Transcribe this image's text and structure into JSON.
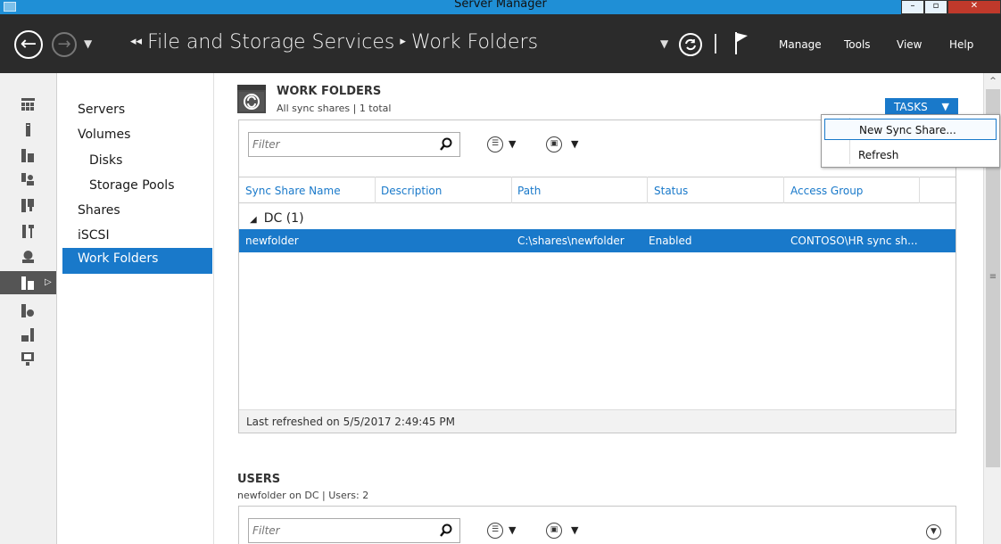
{
  "window": {
    "title": "Server Manager",
    "min": "–",
    "max": "▫",
    "close": "✕"
  },
  "header": {
    "back": "←",
    "forward": "→",
    "breadcrumb_arrows": "◂◂",
    "breadcrumb": [
      "File and Storage Services",
      "Work Folders"
    ],
    "breadcrumb_sep": "▸",
    "menus": [
      "Manage",
      "Tools",
      "View",
      "Help"
    ]
  },
  "sidebar": {
    "items": [
      "Servers",
      "Volumes",
      "Disks",
      "Storage Pools",
      "Shares",
      "iSCSI",
      "Work Folders"
    ],
    "active": "Work Folders"
  },
  "work_folders": {
    "title": "WORK FOLDERS",
    "subtitle": "All sync shares | 1 total",
    "tasks_label": "TASKS",
    "filter_placeholder": "Filter",
    "columns": [
      "Sync Share Name",
      "Description",
      "Path",
      "Status",
      "Access Group"
    ],
    "group": "DC (1)",
    "rows": [
      {
        "name": "newfolder",
        "description": "",
        "path": "C:\\shares\\newfolder",
        "status": "Enabled",
        "access_group": "CONTOSO\\HR sync sh..."
      }
    ],
    "last_refreshed": "Last refreshed on 5/5/2017 2:49:45 PM"
  },
  "users": {
    "title": "USERS",
    "subtitle": "newfolder on DC | Users: 2",
    "filter_placeholder": "Filter"
  },
  "tasks_menu": {
    "items": [
      "New Sync Share...",
      "Refresh"
    ]
  },
  "colors": {
    "accent": "#1979ca",
    "header_bg": "#2b2b2b",
    "titlebar": "#1f8fd6"
  }
}
